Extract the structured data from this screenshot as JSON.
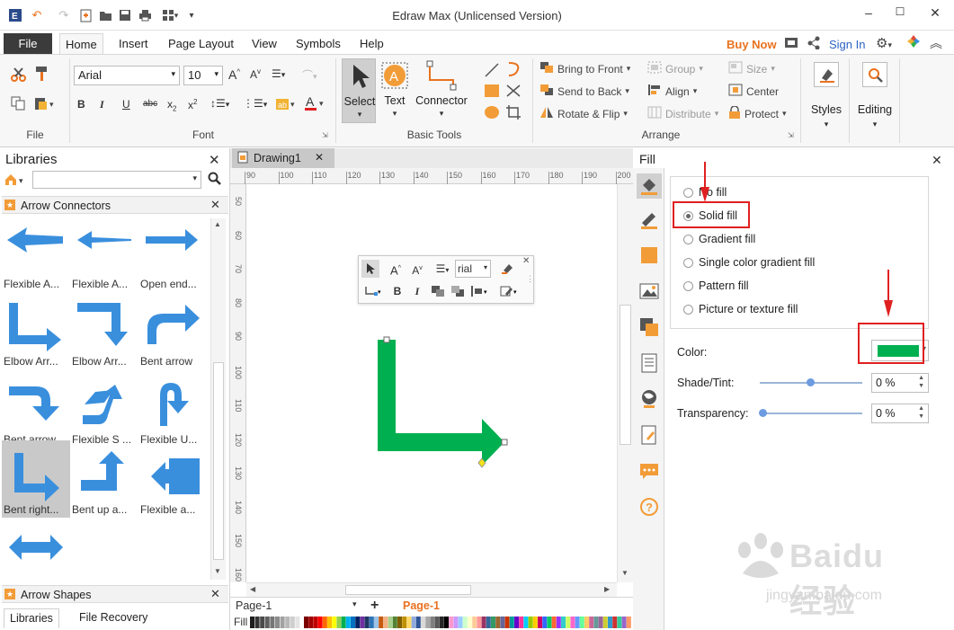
{
  "app": {
    "title": "Edraw Max (Unlicensed Version)"
  },
  "menu": {
    "file": "File",
    "tabs": [
      "Home",
      "Insert",
      "Page Layout",
      "View",
      "Symbols",
      "Help"
    ],
    "buy_now": "Buy Now",
    "sign_in": "Sign In"
  },
  "ribbon": {
    "groups": {
      "file": "File",
      "font": "Font",
      "basic_tools": "Basic Tools",
      "arrange": "Arrange"
    },
    "font_name": "Arial",
    "font_size": "10",
    "tools": {
      "select": "Select",
      "text": "Text",
      "connector": "Connector"
    },
    "arrange": {
      "bring_to_front": "Bring to Front",
      "send_to_back": "Send to Back",
      "rotate_flip": "Rotate & Flip",
      "group": "Group",
      "align": "Align",
      "distribute": "Distribute",
      "size": "Size",
      "center": "Center",
      "protect": "Protect"
    },
    "styles": "Styles",
    "editing": "Editing",
    "accent": "#f29c38"
  },
  "libraries": {
    "title": "Libraries",
    "section": "Arrow Connectors",
    "shapes": [
      "Flexible A...",
      "Flexible A...",
      "Open end...",
      "Elbow Arr...",
      "Elbow Arr...",
      "Bent arrow",
      "Bent arrow",
      "Flexible S ...",
      "Flexible U...",
      "Bent right...",
      "Bent up a...",
      "Flexible a..."
    ],
    "section2": "Arrow Shapes",
    "bottom_tabs": [
      "Libraries",
      "File Recovery"
    ],
    "shape_color": "#3a8fdd"
  },
  "document": {
    "tab": "Drawing1",
    "hruler": [
      "90",
      "100",
      "110",
      "120",
      "130",
      "140",
      "150",
      "160",
      "170",
      "180",
      "190",
      "200"
    ],
    "vruler": [
      "50",
      "60",
      "70",
      "80",
      "90",
      "100",
      "110",
      "120",
      "130",
      "140",
      "150",
      "160"
    ],
    "page_selector": "Page-1",
    "active_page": "Page-1",
    "fill_label": "Fill",
    "shape_fill": "#00b050",
    "mini_font": "rial"
  },
  "fill_panel": {
    "title": "Fill",
    "options": [
      "No fill",
      "Solid fill",
      "Gradient fill",
      "Single color gradient fill",
      "Pattern fill",
      "Picture or texture fill"
    ],
    "selected": "Solid fill",
    "color_label": "Color:",
    "color_value": "#00b050",
    "shade_label": "Shade/Tint:",
    "shade_value": "0 %",
    "transparency_label": "Transparency:",
    "transparency_value": "0 %"
  },
  "watermark": {
    "text": "Baidu经验",
    "url": "jingyan.baidu.com"
  }
}
